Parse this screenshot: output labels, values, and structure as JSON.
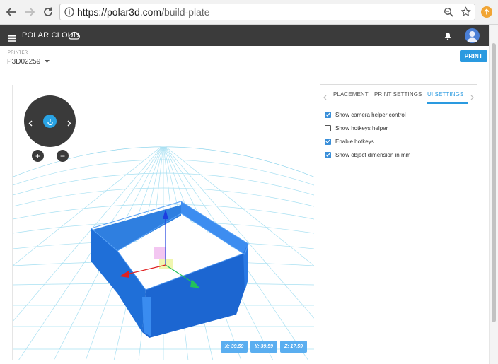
{
  "browser": {
    "url_host": "https://polar3d.com",
    "url_path": "/build-plate",
    "icons": [
      "back-arrow-icon",
      "forward-arrow-icon",
      "reload-icon",
      "info-icon",
      "zoom-icon",
      "star-icon",
      "update-icon"
    ]
  },
  "appbar": {
    "brand": "POLAR CLOUD",
    "icons": [
      "menu-icon",
      "cloud-icon",
      "bell-icon",
      "avatar-icon"
    ]
  },
  "printer": {
    "label": "PRINTER",
    "value": "P3D02259"
  },
  "print_button": "PRINT",
  "viewer": {
    "coords": {
      "x": "X: 39.59",
      "y": "Y: 39.59",
      "z": "Z: 17.59"
    },
    "zoom_in": "+",
    "zoom_out": "−"
  },
  "panel": {
    "tabs": [
      "PLACEMENT",
      "PRINT SETTINGS",
      "UI SETTINGS"
    ],
    "active_tab": "UI SETTINGS",
    "options": [
      {
        "label": "Show camera helper control",
        "checked": true
      },
      {
        "label": "Show hotkeys helper",
        "checked": false
      },
      {
        "label": "Enable hotkeys",
        "checked": true
      },
      {
        "label": "Show object dimension in mm",
        "checked": true
      }
    ]
  },
  "colors": {
    "accent": "#2a9ae0",
    "appbar": "#3b3b3b",
    "object": "#1f6fd8",
    "grid": "#8fd6ee"
  }
}
